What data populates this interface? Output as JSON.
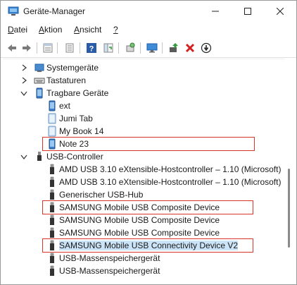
{
  "window": {
    "title": "Geräte-Manager"
  },
  "menu": [
    {
      "label": "Datei",
      "accel": "D",
      "rest": "atei"
    },
    {
      "label": "Aktion",
      "accel": "A",
      "rest": "ktion"
    },
    {
      "label": "Ansicht",
      "accel": "A",
      "rest": "nsicht"
    },
    {
      "label": "?",
      "accel": "?",
      "rest": ""
    }
  ],
  "toolbar": [
    "back-icon",
    "forward-icon",
    "properties-icon",
    "show-hidden-icon",
    "help-icon",
    "update-view-icon",
    "scan-hardware-icon",
    "monitor-icon",
    "enable-driver-icon",
    "uninstall-icon",
    "disable-icon"
  ],
  "tree": {
    "rows": [
      {
        "label": "Systemgeräte",
        "level": 1,
        "expander": "collapsed",
        "icon": "system-icon"
      },
      {
        "label": "Tastaturen",
        "level": 1,
        "expander": "collapsed",
        "icon": "keyboard-icon"
      },
      {
        "label": "Tragbare Geräte",
        "level": 1,
        "expander": "expanded",
        "icon": "portable-device-icon"
      },
      {
        "label": "ext",
        "level": 2,
        "expander": "none",
        "icon": "portable-device-icon"
      },
      {
        "label": "Jumi Tab",
        "level": 2,
        "expander": "none",
        "icon": "tablet-icon"
      },
      {
        "label": "My Book 14",
        "level": 2,
        "expander": "none",
        "icon": "tablet-icon"
      },
      {
        "label": "Note 23",
        "level": 2,
        "expander": "none",
        "icon": "portable-device-icon",
        "highlighted": true
      },
      {
        "label": "USB-Controller",
        "level": 1,
        "expander": "expanded",
        "icon": "usb-icon"
      },
      {
        "label": "AMD USB 3.10 eXtensible-Hostcontroller – 1.10 (Microsoft)",
        "level": 2,
        "expander": "none",
        "icon": "usb-plug-icon"
      },
      {
        "label": "AMD USB 3.10 eXtensible-Hostcontroller – 1.10 (Microsoft)",
        "level": 2,
        "expander": "none",
        "icon": "usb-plug-icon"
      },
      {
        "label": "Generischer USB-Hub",
        "level": 2,
        "expander": "none",
        "icon": "usb-plug-icon"
      },
      {
        "label": "SAMSUNG Mobile USB Composite Device",
        "level": 2,
        "expander": "none",
        "icon": "usb-plug-icon",
        "highlighted": true
      },
      {
        "label": "SAMSUNG Mobile USB Composite Device",
        "level": 2,
        "expander": "none",
        "icon": "usb-plug-icon"
      },
      {
        "label": "SAMSUNG Mobile USB Composite Device",
        "level": 2,
        "expander": "none",
        "icon": "usb-plug-icon"
      },
      {
        "label": "SAMSUNG Mobile USB Connectivity Device V2",
        "level": 2,
        "expander": "none",
        "icon": "usb-plug-icon",
        "highlighted": true,
        "selected": true
      },
      {
        "label": "USB-Massenspeichergerät",
        "level": 2,
        "expander": "none",
        "icon": "usb-plug-icon"
      },
      {
        "label": "USB-Massenspeichergerät",
        "level": 2,
        "expander": "none",
        "icon": "usb-plug-icon"
      }
    ]
  },
  "colors": {
    "highlight_border": "#d9352b",
    "selection": "#cce4f7",
    "icon_blue": "#1e6fd0",
    "delete_red": "#d32020",
    "green": "#2e9a3a"
  }
}
